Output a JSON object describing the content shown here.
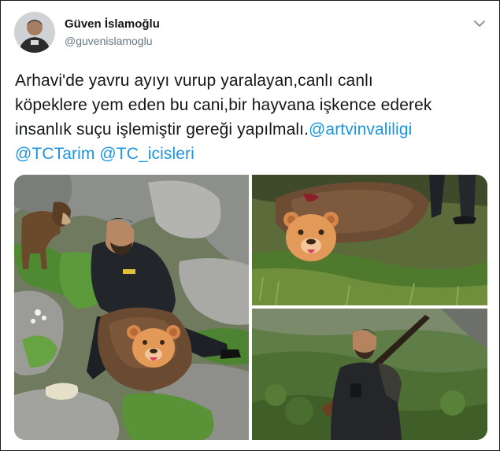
{
  "author": {
    "name": "Güven İslamoğlu",
    "handle": "@guvenislamoglu"
  },
  "tweet": {
    "line1": "Arhavi'de yavru ayıyı vurup yaralayan,canlı canlı",
    "line2": "köpeklere yem eden bu cani,bir hayvana işkence ederek",
    "line3_text": "insanlık suçu işlemiştir gereği yapılmalı.",
    "mentions": [
      "@artvinvaliligi",
      "@TCTarim",
      "@TC_icisleri"
    ]
  },
  "icons": {
    "options": "chevron-down-icon",
    "bear_censor": "bear-face-icon"
  },
  "colors": {
    "link": "#1b95e0",
    "handle": "#657786",
    "text": "#14171a"
  }
}
